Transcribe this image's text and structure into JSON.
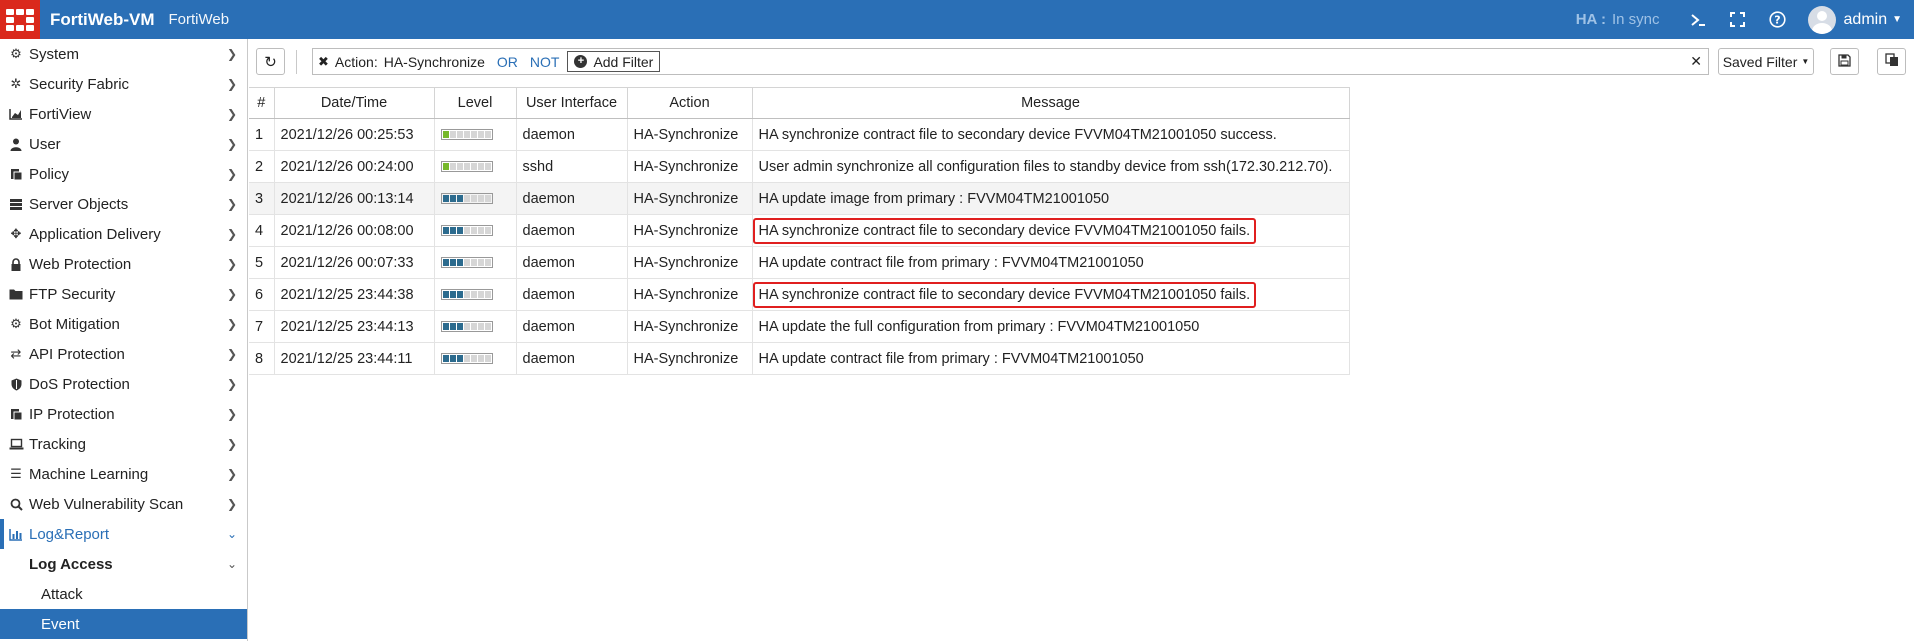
{
  "topbar": {
    "product": "FortiWeb-VM",
    "subtitle": "FortiWeb",
    "ha_label": "HA :",
    "ha_status": "In sync",
    "user": "admin"
  },
  "sidebar": {
    "items": [
      {
        "label": "System",
        "icon": "gear-icon"
      },
      {
        "label": "Security Fabric",
        "icon": "fabric-icon"
      },
      {
        "label": "FortiView",
        "icon": "chart-icon"
      },
      {
        "label": "User",
        "icon": "user-icon"
      },
      {
        "label": "Policy",
        "icon": "policy-icon"
      },
      {
        "label": "Server Objects",
        "icon": "server-icon"
      },
      {
        "label": "Application Delivery",
        "icon": "arrows-icon"
      },
      {
        "label": "Web Protection",
        "icon": "lock-icon"
      },
      {
        "label": "FTP Security",
        "icon": "folder-icon"
      },
      {
        "label": "Bot Mitigation",
        "icon": "bot-icon"
      },
      {
        "label": "API Protection",
        "icon": "exchange-icon"
      },
      {
        "label": "DoS Protection",
        "icon": "shield-icon"
      },
      {
        "label": "IP Protection",
        "icon": "ip-icon"
      },
      {
        "label": "Tracking",
        "icon": "laptop-icon"
      },
      {
        "label": "Machine Learning",
        "icon": "bars-icon"
      },
      {
        "label": "Web Vulnerability Scan",
        "icon": "scan-icon"
      },
      {
        "label": "Log&Report",
        "icon": "report-icon"
      }
    ],
    "sub": {
      "label": "Log Access"
    },
    "leaves": [
      {
        "label": "Attack"
      },
      {
        "label": "Event"
      }
    ]
  },
  "toolbar": {
    "filter_field": "Action:",
    "filter_value": "HA-Synchronize",
    "or_label": "OR",
    "not_label": "NOT",
    "add_filter": "Add Filter",
    "saved_filter": "Saved Filter"
  },
  "table": {
    "headers": [
      "#",
      "Date/Time",
      "Level",
      "User Interface",
      "Action",
      "Message"
    ],
    "rows": [
      {
        "num": "1",
        "datetime": "2021/12/26 00:25:53",
        "level": "info",
        "ui": "daemon",
        "action": "HA-Synchronize",
        "message": "HA synchronize contract file to secondary device FVVM04TM21001050 success.",
        "highlight": false
      },
      {
        "num": "2",
        "datetime": "2021/12/26 00:24:00",
        "level": "info",
        "ui": "sshd",
        "action": "HA-Synchronize",
        "message": "User admin synchronize all configuration files to standby device from ssh(172.30.212.70).",
        "highlight": false
      },
      {
        "num": "3",
        "datetime": "2021/12/26 00:13:14",
        "level": "notice",
        "ui": "daemon",
        "action": "HA-Synchronize",
        "message": "HA update image from primary : FVVM04TM21001050",
        "highlight": false
      },
      {
        "num": "4",
        "datetime": "2021/12/26 00:08:00",
        "level": "notice",
        "ui": "daemon",
        "action": "HA-Synchronize",
        "message": "HA synchronize contract file to secondary device FVVM04TM21001050 fails.",
        "highlight": true
      },
      {
        "num": "5",
        "datetime": "2021/12/26 00:07:33",
        "level": "notice",
        "ui": "daemon",
        "action": "HA-Synchronize",
        "message": "HA update contract file from primary : FVVM04TM21001050",
        "highlight": false
      },
      {
        "num": "6",
        "datetime": "2021/12/25 23:44:38",
        "level": "notice",
        "ui": "daemon",
        "action": "HA-Synchronize",
        "message": "HA synchronize contract file to secondary device FVVM04TM21001050 fails.",
        "highlight": true
      },
      {
        "num": "7",
        "datetime": "2021/12/25 23:44:13",
        "level": "notice",
        "ui": "daemon",
        "action": "HA-Synchronize",
        "message": "HA update the full configuration from primary : FVVM04TM21001050",
        "highlight": false
      },
      {
        "num": "8",
        "datetime": "2021/12/25 23:44:11",
        "level": "notice",
        "ui": "daemon",
        "action": "HA-Synchronize",
        "message": "HA update contract file from primary : FVVM04TM21001050",
        "highlight": false
      }
    ]
  },
  "colors": {
    "brand_blue": "#2a6fb6",
    "logo_red": "#da291c",
    "level_info": "#76b82a",
    "level_notice": "#2c6b8e",
    "highlight_red": "#e01f1f"
  }
}
